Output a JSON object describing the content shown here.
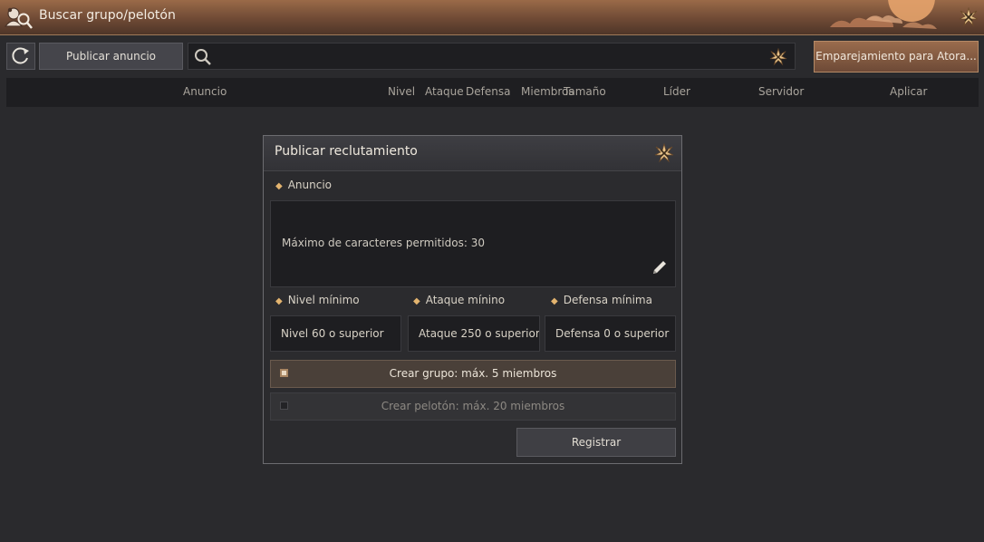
{
  "window": {
    "title": "Buscar grupo/pelotón"
  },
  "toolbar": {
    "publish_label": "Publicar anuncio",
    "search_value": "",
    "matching_label": "Emparejamiento para Atora..."
  },
  "table_headers": {
    "announcement": "Anuncio",
    "level": "Nivel",
    "attack": "Ataque",
    "defense": "Defensa",
    "members": "Miembros",
    "size": "Tamaño",
    "leader": "Líder",
    "server": "Servidor",
    "apply": "Aplicar"
  },
  "dialog": {
    "title": "Publicar reclutamiento",
    "announcement_label": "Anuncio",
    "announcement_placeholder": "Máximo de caracteres permitidos: 30",
    "min_level_label": "Nivel mínimo",
    "min_attack_label": "Ataque mínino",
    "min_defense_label": "Defensa mínima",
    "min_level_value": "Nivel 60 o superior",
    "min_attack_value": "Ataque 250 o superior",
    "min_defense_value": "Defensa 0 o superior",
    "options": [
      {
        "label": "Crear grupo: máx. 5 miembros",
        "selected": true
      },
      {
        "label": "Crear pelotón: máx. 20 miembros",
        "selected": false
      }
    ],
    "register_label": "Registrar"
  },
  "colors": {
    "accent": "#e3b46f",
    "title_bar": "#6f4a35",
    "background": "#2a2a2d"
  },
  "icons": [
    "party-emblem-icon",
    "close-icon",
    "refresh-icon",
    "search-icon",
    "clear-icon",
    "pencil-icon",
    "checkbox-icon"
  ]
}
